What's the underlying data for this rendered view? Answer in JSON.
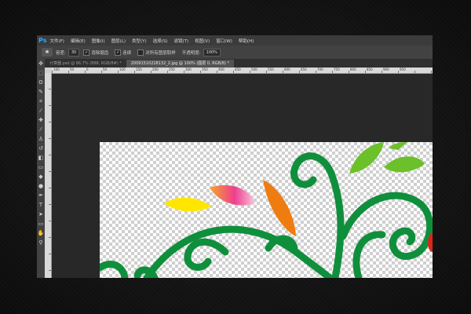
{
  "app": {
    "logo": "Ps"
  },
  "menu": [
    "文件(F)",
    "编辑(E)",
    "图像(I)",
    "图层(L)",
    "类型(Y)",
    "选择(S)",
    "滤镜(T)",
    "视图(V)",
    "窗口(W)",
    "帮助(H)"
  ],
  "options": {
    "tool_icon": "magic-wand-icon",
    "tolerance_label": "容差:",
    "tolerance_value": "30",
    "antialias_label": "消除锯齿",
    "contiguous_label": "连续",
    "sample_all_label": "对所有图层取样",
    "opacity_label": "不透明度:",
    "opacity_value": "100%"
  },
  "tabs": [
    {
      "label": "计算器.psd @ 66.7% (888, RGB/8#) *",
      "active": false
    },
    {
      "label": "20091510228132_2.jpg @ 100% (图层 0, RGB/8) *",
      "active": true
    }
  ],
  "ruler_ticks": [
    "100",
    "50",
    "0",
    "50",
    "100",
    "150",
    "200",
    "250",
    "300",
    "350",
    "400",
    "450",
    "500",
    "550",
    "600",
    "650",
    "700",
    "750",
    "800",
    "850",
    "900",
    "950"
  ],
  "colors": {
    "accent": "#31a8ff",
    "vine": "#0f8f3c",
    "leaf_green": "#6cc02a",
    "leaf_orange": "#ef7c10",
    "leaf_yellow": "#ffe600",
    "leaf_pink": "#ee3e8f"
  }
}
